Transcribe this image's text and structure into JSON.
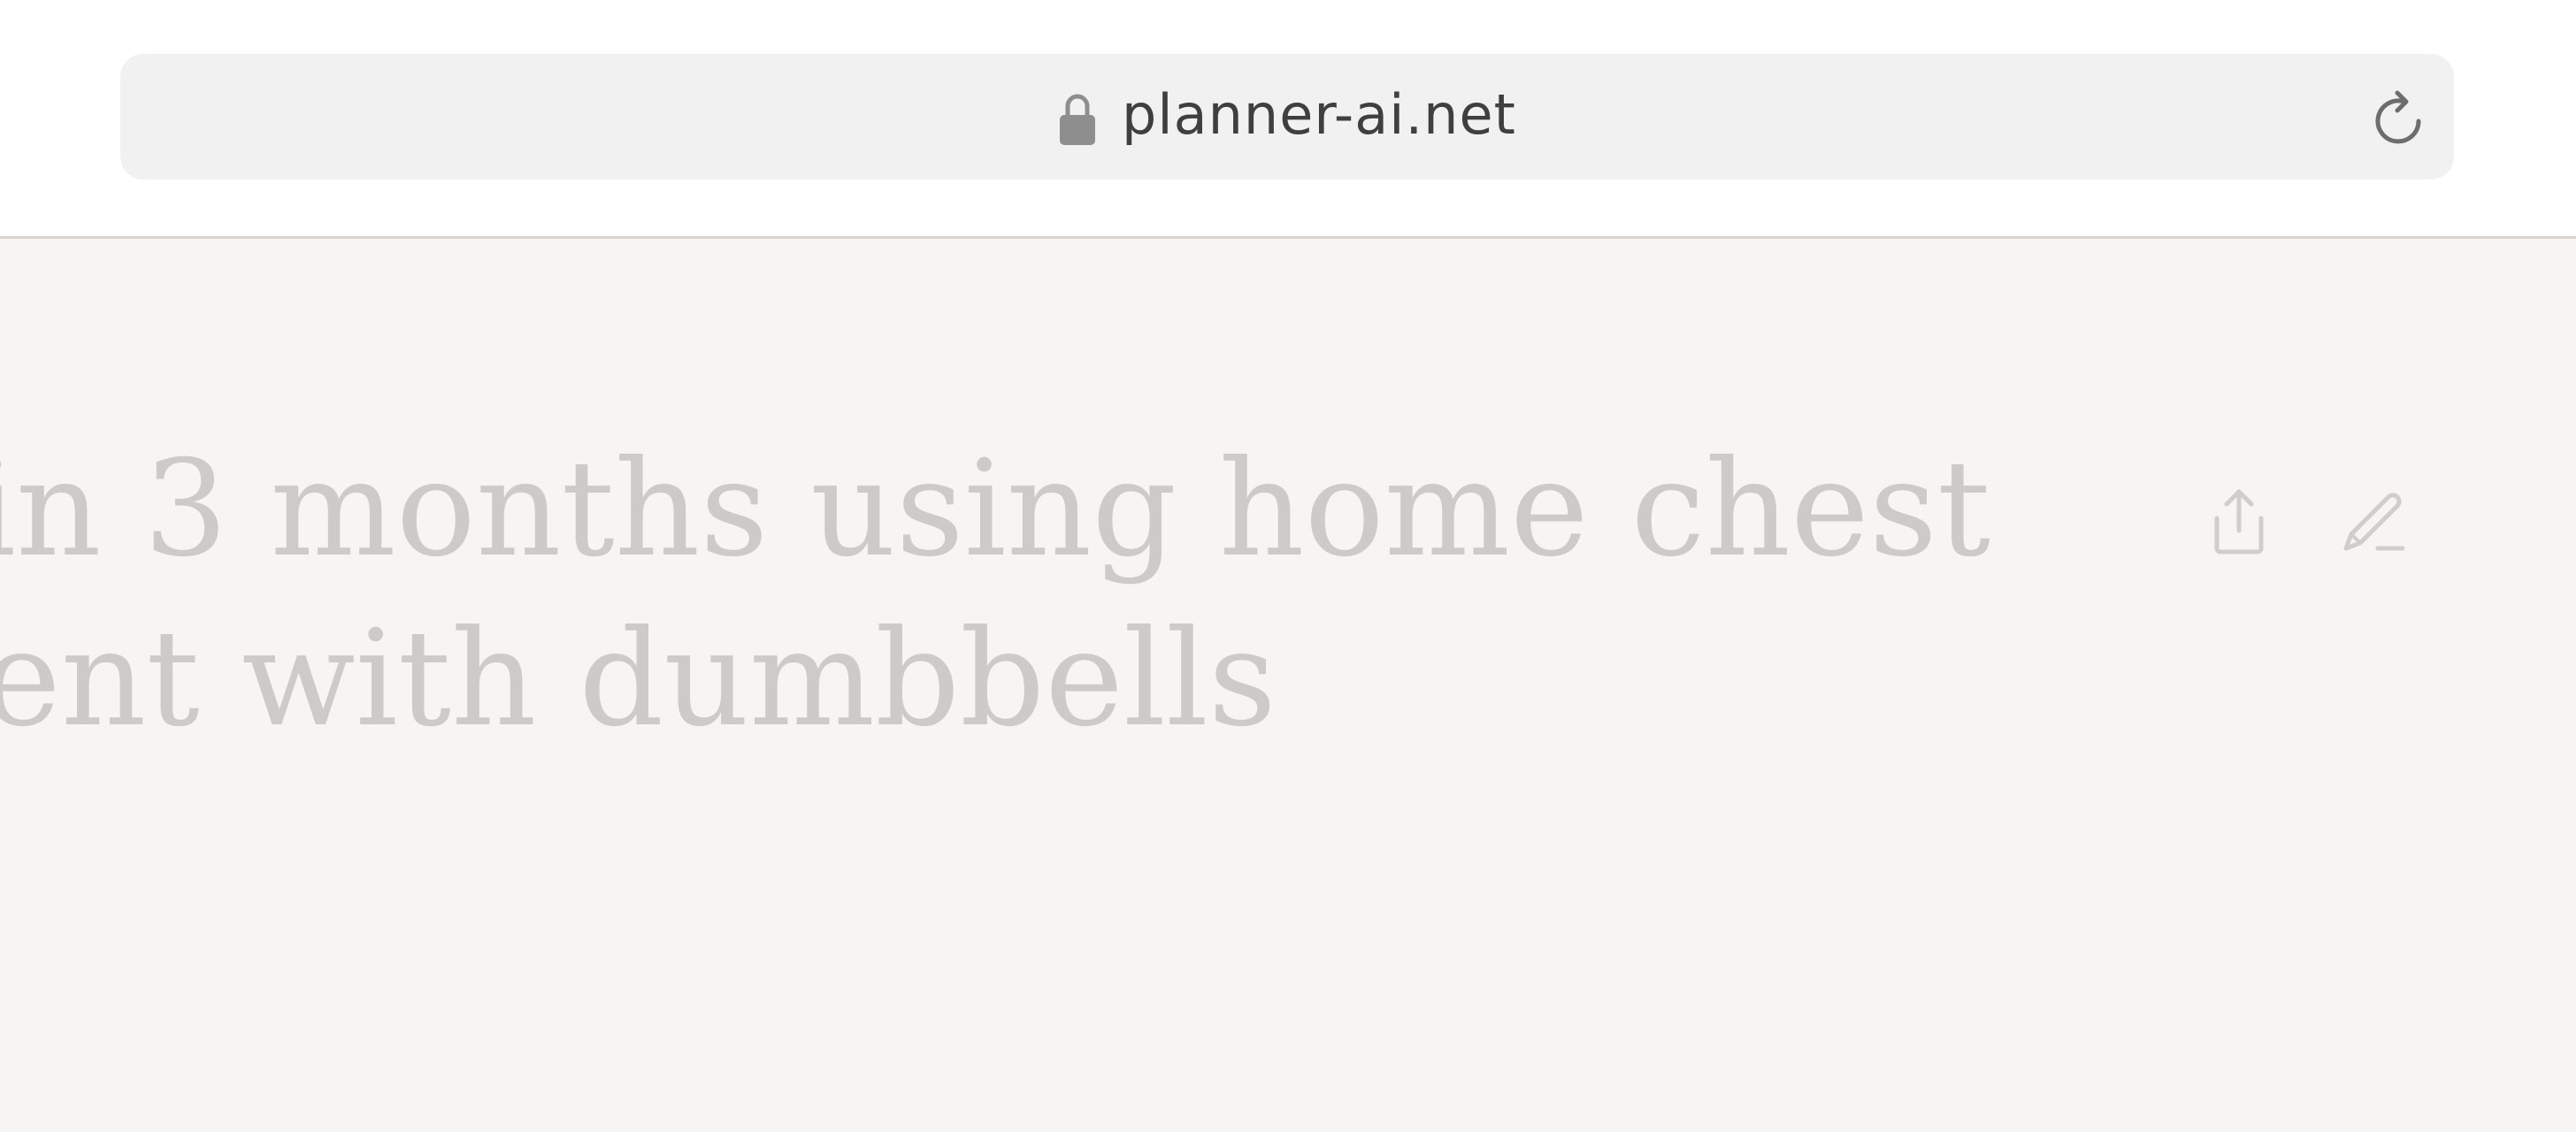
{
  "browser": {
    "url": "planner-ai.net",
    "lock_icon": "lock-icon",
    "reload_icon": "reload-icon"
  },
  "page": {
    "title_line_1": "in 3 months using home chest",
    "title_line_2": "ent with dumbbells",
    "share_icon": "share-icon",
    "edit_icon": "edit-icon"
  },
  "colors": {
    "chrome_bg": "#ffffff",
    "address_bar_bg": "#f1f1f1",
    "page_bg": "#f6f5f3",
    "title_text": "#cccbc8",
    "url_text": "#3f3f3f",
    "icon_faded": "#cfcecb"
  }
}
